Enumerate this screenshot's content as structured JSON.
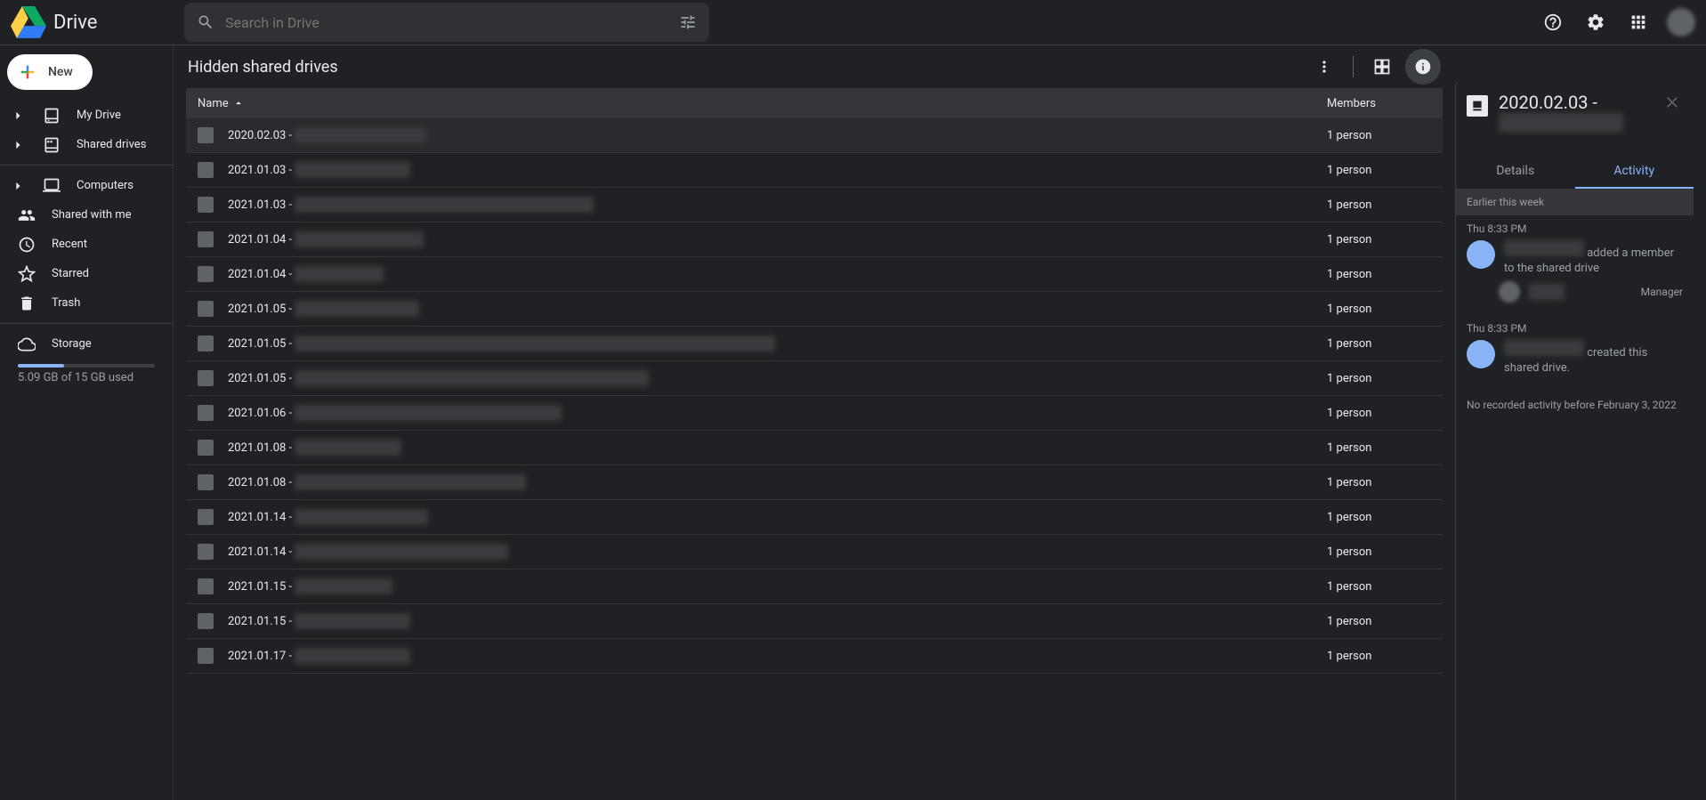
{
  "app": {
    "name": "Drive"
  },
  "search": {
    "placeholder": "Search in Drive"
  },
  "newButton": "New",
  "sidebar": {
    "items": [
      {
        "label": "My Drive",
        "expandable": true
      },
      {
        "label": "Shared drives",
        "expandable": true
      },
      {
        "label": "Computers",
        "expandable": true
      }
    ],
    "items2": [
      {
        "label": "Shared with me"
      },
      {
        "label": "Recent"
      },
      {
        "label": "Starred"
      },
      {
        "label": "Trash"
      }
    ],
    "storage": {
      "label": "Storage",
      "usage": "5.09 GB of 15 GB used"
    }
  },
  "page": {
    "title": "Hidden shared drives",
    "columns": {
      "name": "Name",
      "members": "Members"
    }
  },
  "rows": [
    {
      "name": "2020.02.03 -",
      "members": "1 person",
      "redactW": 148,
      "selected": true
    },
    {
      "name": "2021.01.03 -",
      "members": "1 person",
      "redactW": 130
    },
    {
      "name": "2021.01.03 -",
      "members": "1 person",
      "redactW": 336
    },
    {
      "name": "2021.01.04 -",
      "members": "1 person",
      "redactW": 145
    },
    {
      "name": "2021.01.04 -",
      "members": "1 person",
      "redactW": 100
    },
    {
      "name": "2021.01.05 -",
      "members": "1 person",
      "redactW": 140
    },
    {
      "name": "2021.01.05 -",
      "members": "1 person",
      "redactW": 540
    },
    {
      "name": "2021.01.05 -",
      "members": "1 person",
      "redactW": 398
    },
    {
      "name": "2021.01.06 -",
      "members": "1 person",
      "redactW": 300
    },
    {
      "name": "2021.01.08 -",
      "members": "1 person",
      "redactW": 120
    },
    {
      "name": "2021.01.08 -",
      "members": "1 person",
      "redactW": 260
    },
    {
      "name": "2021.01.14 -",
      "members": "1 person",
      "redactW": 150
    },
    {
      "name": "2021.01.14 -",
      "members": "1 person",
      "redactW": 240
    },
    {
      "name": "2021.01.15 -",
      "members": "1 person",
      "redactW": 110
    },
    {
      "name": "2021.01.15 -",
      "members": "1 person",
      "redactW": 130
    },
    {
      "name": "2021.01.17 -",
      "members": "1 person",
      "redactW": 130
    }
  ],
  "panel": {
    "title": "2020.02.03 -",
    "tabs": {
      "details": "Details",
      "activity": "Activity"
    },
    "section": "Earlier this week",
    "events": [
      {
        "time": "Thu 8:33 PM",
        "text": "added a member to the shared drive",
        "role": "Manager"
      },
      {
        "time": "Thu 8:33 PM",
        "text": "created this shared drive."
      }
    ],
    "noActivity": "No recorded activity before February 3, 2022"
  }
}
